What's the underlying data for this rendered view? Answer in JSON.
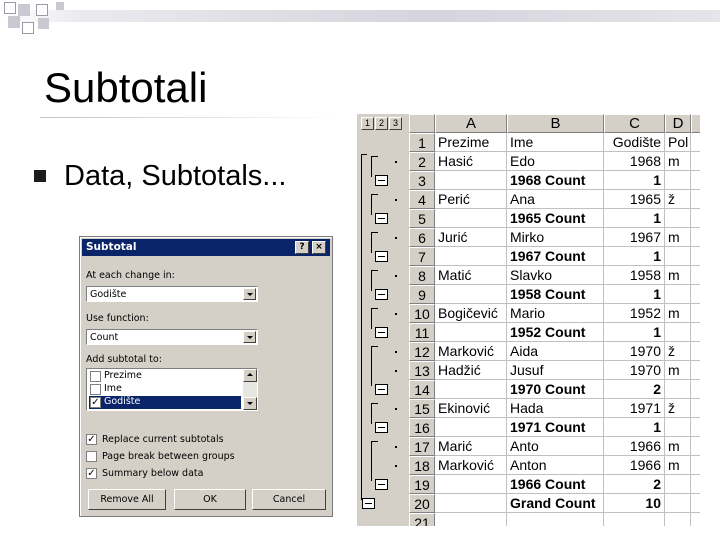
{
  "slide": {
    "title": "Subtotali",
    "bullets": [
      "Data, Subtotals..."
    ]
  },
  "dialog": {
    "title": "Subtotal",
    "help_btn": "?",
    "close_btn": "×",
    "change_label": "At each change in:",
    "change_value": "Godište",
    "function_label": "Use function:",
    "function_value": "Count",
    "add_label": "Add subtotal to:",
    "fields": [
      {
        "label": "Prezime",
        "checked": false,
        "selected": false
      },
      {
        "label": "Ime",
        "checked": false,
        "selected": false
      },
      {
        "label": "Godište",
        "checked": true,
        "selected": true
      }
    ],
    "options": [
      {
        "label": "Replace current subtotals",
        "checked": true
      },
      {
        "label": "Page break between groups",
        "checked": false
      },
      {
        "label": "Summary below data",
        "checked": true
      }
    ],
    "remove_all": "Remove All",
    "ok": "OK",
    "cancel": "Cancel"
  },
  "sheet": {
    "outline_levels": [
      "1",
      "2",
      "3"
    ],
    "columns": [
      "A",
      "B",
      "C",
      "D"
    ],
    "rows": [
      {
        "n": "1",
        "a": "Prezime",
        "b": "Ime",
        "c": "Godište",
        "d": "Pol",
        "bold": false
      },
      {
        "n": "2",
        "a": "Hasić",
        "b": "Edo",
        "c": "1968",
        "d": "m",
        "bold": false
      },
      {
        "n": "3",
        "a": "",
        "b": "1968 Count",
        "c": "1",
        "d": "",
        "bold": true
      },
      {
        "n": "4",
        "a": "Perić",
        "b": "Ana",
        "c": "1965",
        "d": "ž",
        "bold": false
      },
      {
        "n": "5",
        "a": "",
        "b": "1965 Count",
        "c": "1",
        "d": "",
        "bold": true
      },
      {
        "n": "6",
        "a": "Jurić",
        "b": "Mirko",
        "c": "1967",
        "d": "m",
        "bold": false
      },
      {
        "n": "7",
        "a": "",
        "b": "1967 Count",
        "c": "1",
        "d": "",
        "bold": true
      },
      {
        "n": "8",
        "a": "Matić",
        "b": "Slavko",
        "c": "1958",
        "d": "m",
        "bold": false
      },
      {
        "n": "9",
        "a": "",
        "b": "1958 Count",
        "c": "1",
        "d": "",
        "bold": true
      },
      {
        "n": "10",
        "a": "Bogičević",
        "b": "Mario",
        "c": "1952",
        "d": "m",
        "bold": false
      },
      {
        "n": "11",
        "a": "",
        "b": "1952 Count",
        "c": "1",
        "d": "",
        "bold": true
      },
      {
        "n": "12",
        "a": "Marković",
        "b": "Aida",
        "c": "1970",
        "d": "ž",
        "bold": false
      },
      {
        "n": "13",
        "a": "Hadžić",
        "b": "Jusuf",
        "c": "1970",
        "d": "m",
        "bold": false
      },
      {
        "n": "14",
        "a": "",
        "b": "1970 Count",
        "c": "2",
        "d": "",
        "bold": true
      },
      {
        "n": "15",
        "a": "Ekinović",
        "b": "Hada",
        "c": "1971",
        "d": "ž",
        "bold": false
      },
      {
        "n": "16",
        "a": "",
        "b": "1971 Count",
        "c": "1",
        "d": "",
        "bold": true
      },
      {
        "n": "17",
        "a": "Marić",
        "b": "Anto",
        "c": "1966",
        "d": "m",
        "bold": false
      },
      {
        "n": "18",
        "a": "Marković",
        "b": "Anton",
        "c": "1966",
        "d": "m",
        "bold": false
      },
      {
        "n": "19",
        "a": "",
        "b": "1966 Count",
        "c": "2",
        "d": "",
        "bold": true
      },
      {
        "n": "20",
        "a": "",
        "b": "Grand Count",
        "c": "10",
        "d": "",
        "bold": true
      },
      {
        "n": "21",
        "a": "",
        "b": "",
        "c": "",
        "d": "",
        "bold": false
      }
    ]
  }
}
